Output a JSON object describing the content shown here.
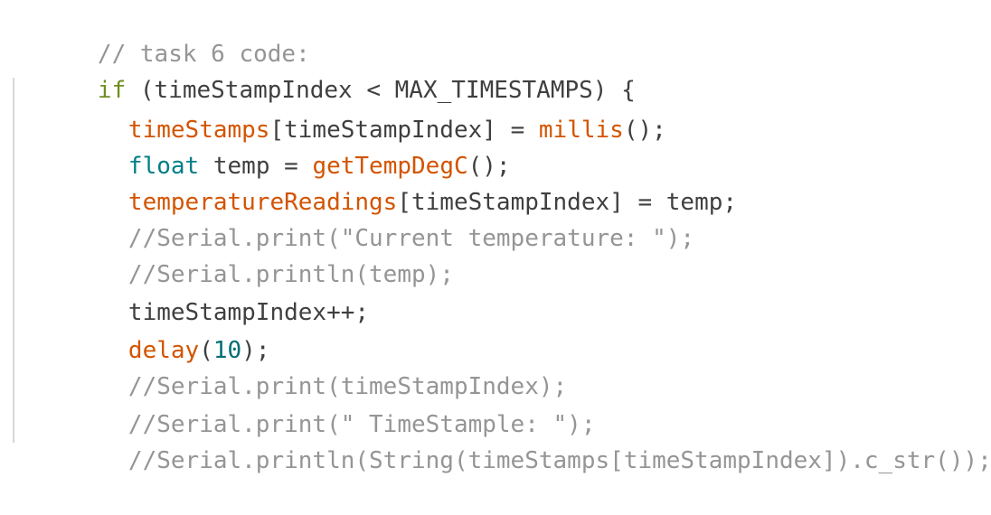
{
  "code": {
    "line_comment_header": "// task 6 code:",
    "line_if": {
      "keyword": "if",
      "rest": " (timeStampIndex < MAX_TIMESTAMPS) {"
    },
    "line_timestamps": {
      "name": "timeStamps",
      "mid": "[timeStampIndex] = ",
      "func": "millis",
      "tail": "();"
    },
    "line_float": {
      "type": "float",
      "mid": " temp = ",
      "func": "getTempDegC",
      "tail": "();"
    },
    "line_temperature": {
      "name": "temperatureReadings",
      "tail": "[timeStampIndex] = temp;"
    },
    "line_comment_1": "//Serial.print(\"Current temperature: \");",
    "line_comment_2": "//Serial.println(temp);",
    "line_increment": "timeStampIndex++;",
    "line_delay": {
      "func": "delay",
      "open": "(",
      "number": "10",
      "close": ");"
    },
    "line_comment_3": "//Serial.print(timeStampIndex);",
    "line_comment_4": "//Serial.print(\" TimeStample: \");",
    "line_comment_5": "//Serial.println(String(timeStamps[timeStampIndex]).c_str());"
  },
  "colors": {
    "background": "#ffffff",
    "comment": "#959595",
    "keyword": "#6f8e1f",
    "type": "#007e87",
    "function": "#d35400",
    "number": "#006d75",
    "text": "#3f3f3f"
  }
}
